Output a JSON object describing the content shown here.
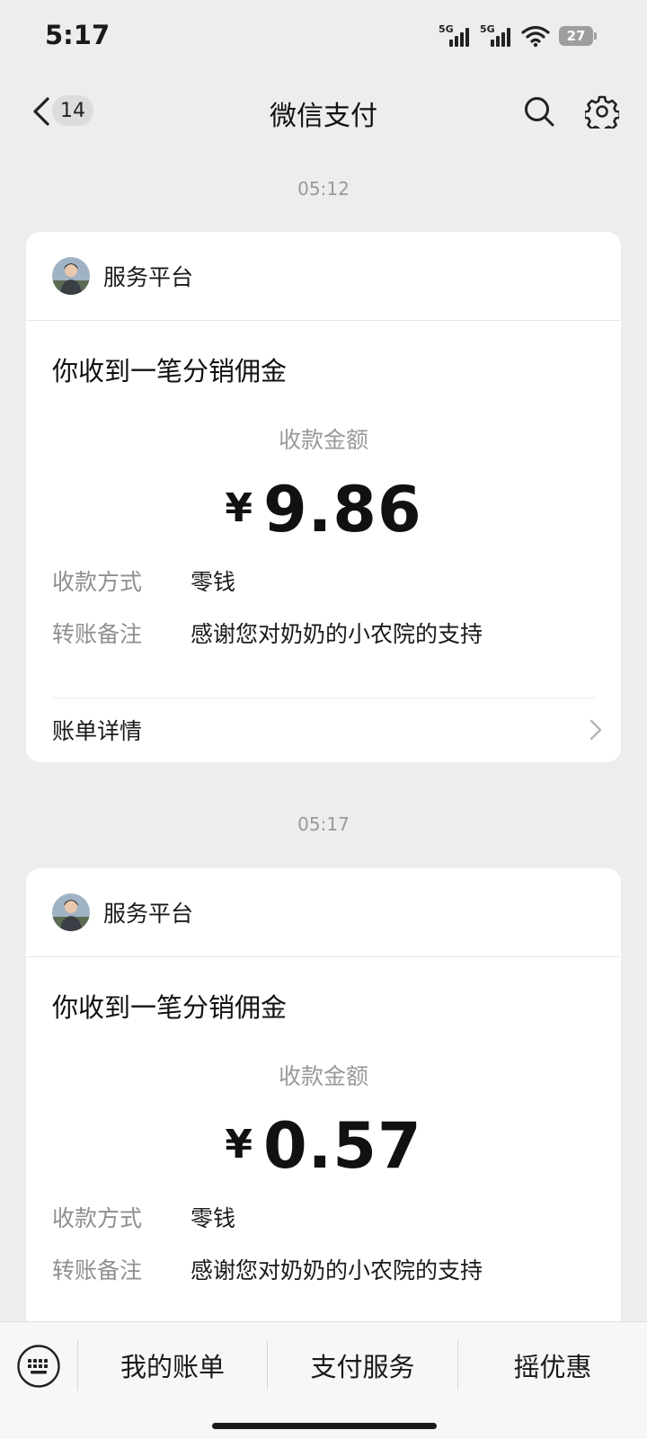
{
  "status_bar": {
    "time": "5:17",
    "signal_label_1": "5G",
    "signal_label_2": "5G",
    "battery": "27"
  },
  "nav": {
    "unread_count": "14",
    "title": "微信支付"
  },
  "messages": [
    {
      "timestamp": "05:12",
      "sender": "服务平台",
      "title": "你收到一笔分销佣金",
      "amount_label": "收款金额",
      "currency": "¥",
      "amount": "9.86",
      "method_label": "收款方式",
      "method_value": "零钱",
      "note_label": "转账备注",
      "note_value": "感谢您对奶奶的小农院的支持",
      "details_label": "账单详情"
    },
    {
      "timestamp": "05:17",
      "sender": "服务平台",
      "title": "你收到一笔分销佣金",
      "amount_label": "收款金额",
      "currency": "¥",
      "amount": "0.57",
      "method_label": "收款方式",
      "method_value": "零钱",
      "note_label": "转账备注",
      "note_value": "感谢您对奶奶的小农院的支持"
    }
  ],
  "bottom_menu": {
    "items": [
      "我的账单",
      "支付服务",
      "摇优惠"
    ]
  },
  "icons": {
    "back": "chevron-left-icon",
    "search": "search-icon",
    "settings": "gear-icon",
    "keyboard": "keyboard-icon",
    "arrow": "chevron-right-icon"
  }
}
